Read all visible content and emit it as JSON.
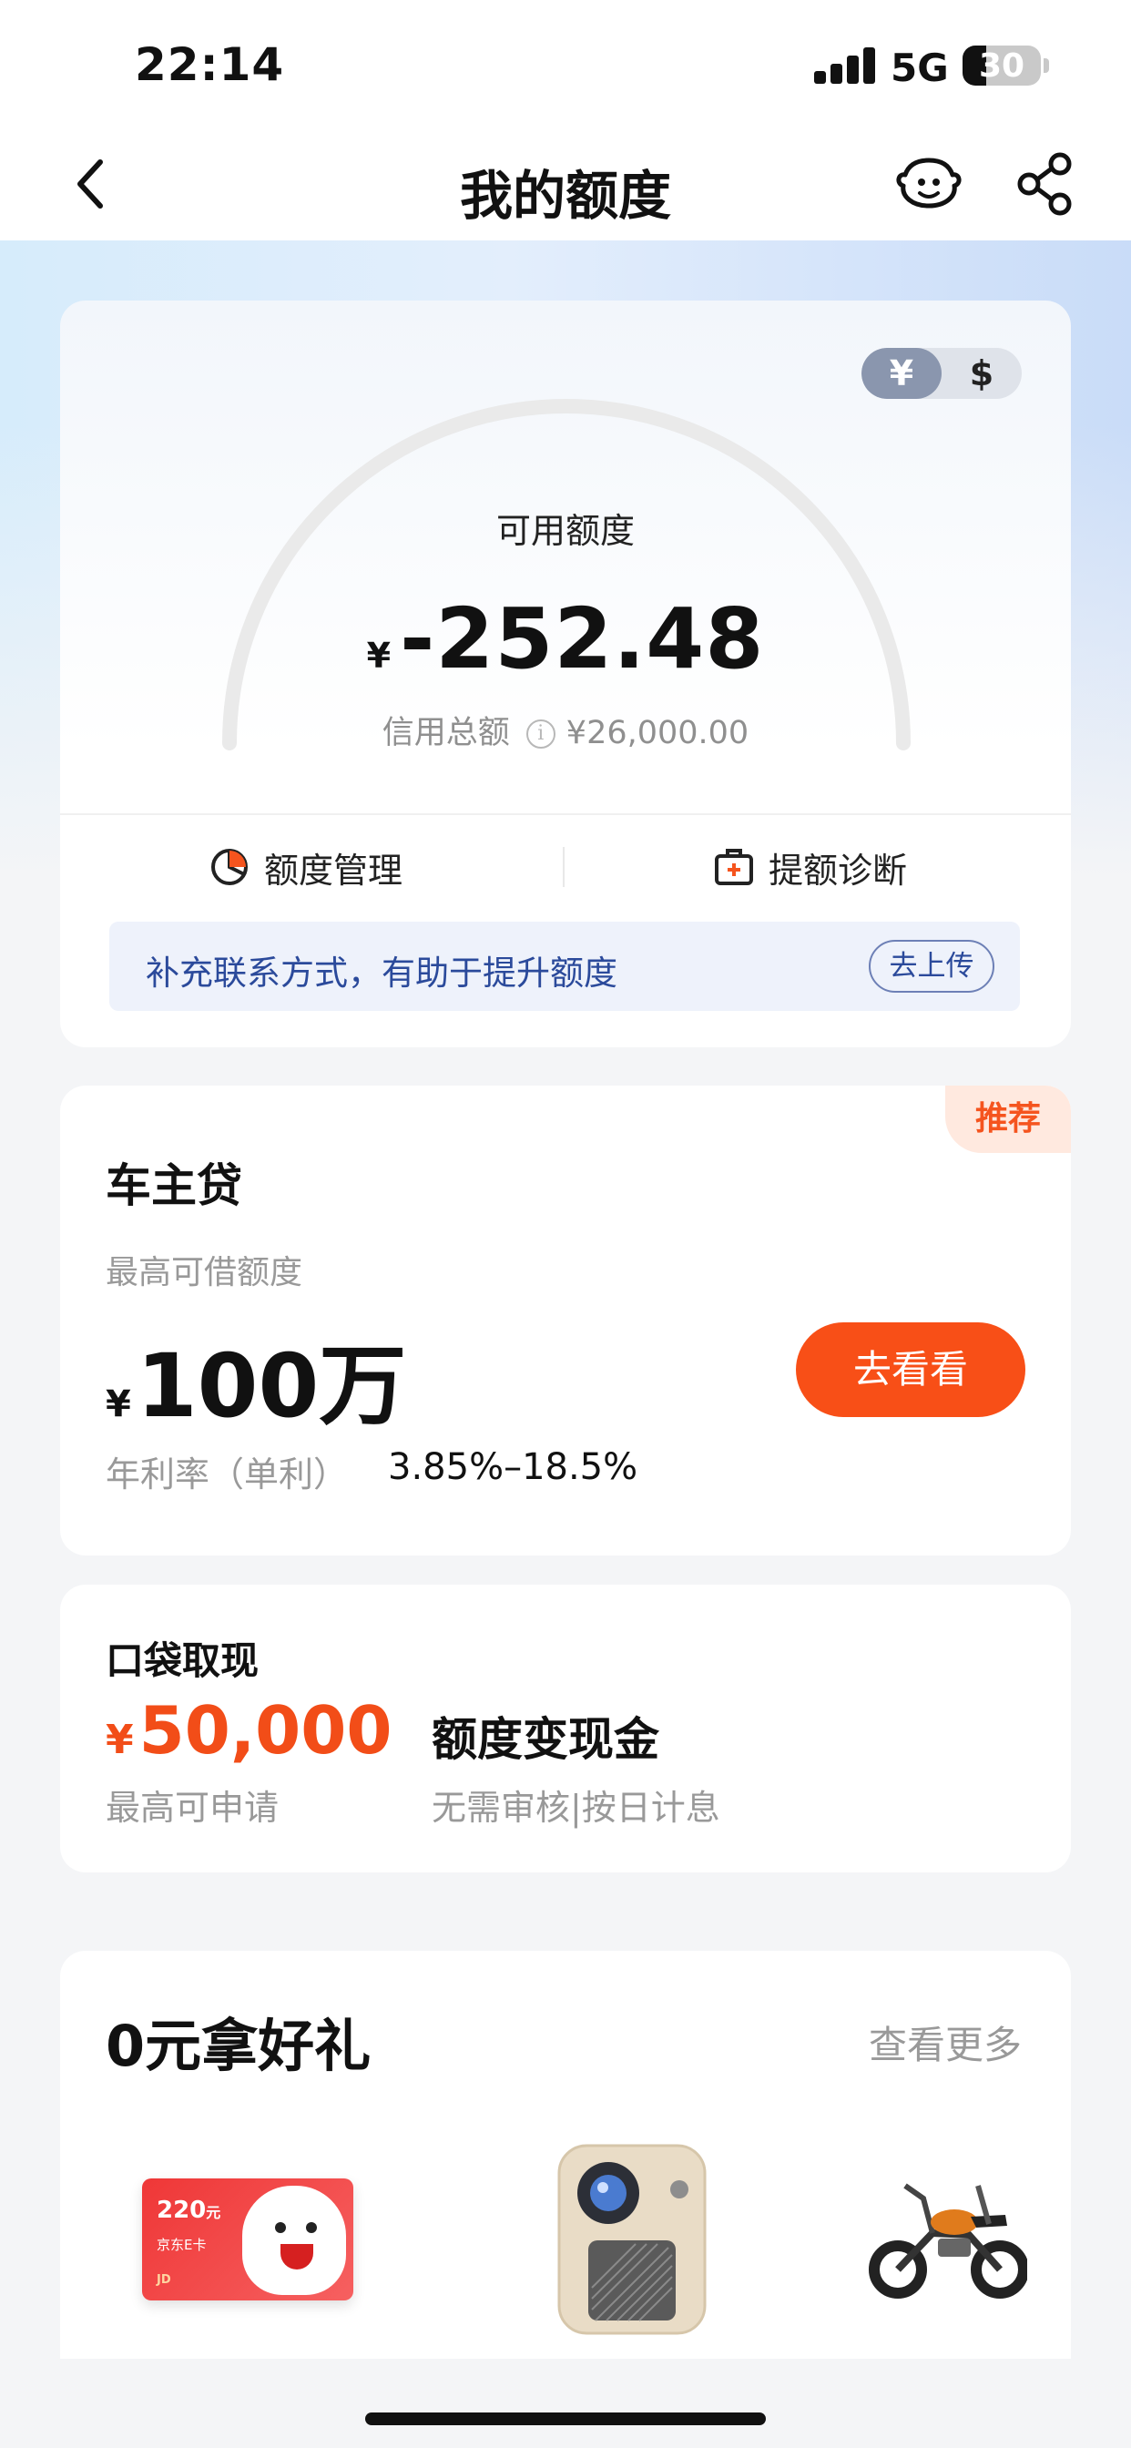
{
  "status_bar": {
    "time": "22:14",
    "network": "5G",
    "battery": "30",
    "battery_level": 0.3
  },
  "nav": {
    "title": "我的额度",
    "icons": [
      "back-arrow-icon",
      "customer-service-icon",
      "share-icon"
    ]
  },
  "credit": {
    "currency_options": [
      "¥",
      "$"
    ],
    "selected_currency": "¥",
    "available_label": "可用额度",
    "currency_symbol": "¥",
    "available_amount": "-252.48",
    "total_label": "信用总额",
    "total_amount": "¥26,000.00",
    "used_fraction": 0,
    "actions": [
      {
        "label": "额度管理",
        "icon": "pie-chart-icon"
      },
      {
        "label": "提额诊断",
        "icon": "medical-kit-icon"
      }
    ],
    "tip": {
      "text": "补充联系方式，有助于提升额度",
      "button": "去上传"
    }
  },
  "car_loan": {
    "badge": "推荐",
    "title": "车主贷",
    "subtitle": "最高可借额度",
    "currency_symbol": "¥",
    "amount": "100万",
    "rate_label": "年利率（单利）",
    "rate_value": "3.85%–18.5%",
    "button": "去看看"
  },
  "pocket_cash": {
    "title": "口袋取现",
    "currency_symbol": "¥",
    "amount": "50,000",
    "amount_sub": "最高可申请",
    "product_title": "额度变现金",
    "product_sub": "无需审核|按日计息"
  },
  "gifts": {
    "title": "0元拿好礼",
    "more": "查看更多",
    "ecard": {
      "value": "220",
      "unit": "元",
      "name": "京东E卡",
      "brand": "JD"
    },
    "items": [
      "jd-ecard",
      "projector",
      "kids-motorbike"
    ]
  },
  "colors": {
    "accent_orange": "#f84f17",
    "link_blue": "#2b4a9b",
    "muted_gray": "#999999",
    "toggle_active": "#8a96ae"
  }
}
